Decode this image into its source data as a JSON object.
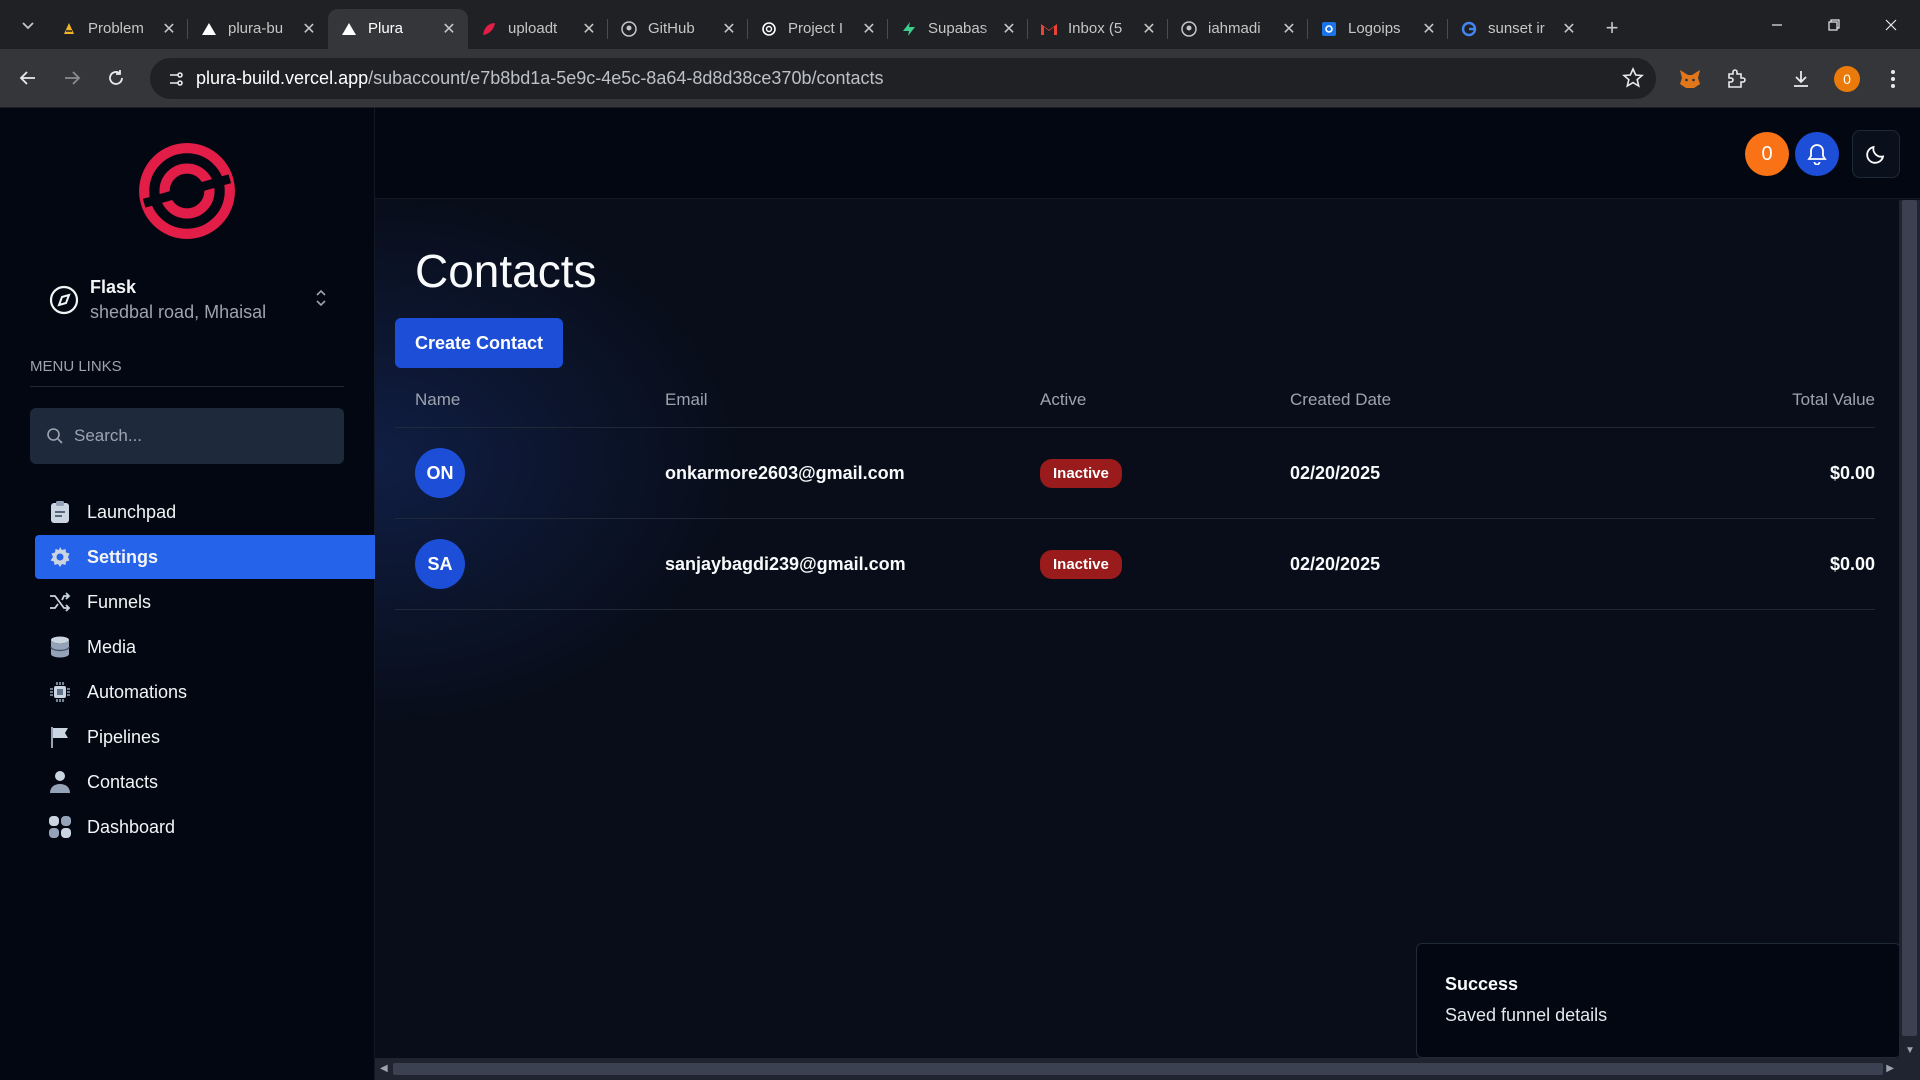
{
  "browser": {
    "tabs": [
      {
        "label": "Problem",
        "favicon": "vscode-icon",
        "color": "#f0b429"
      },
      {
        "label": "plura-bu",
        "favicon": "vercel-icon",
        "color": "#ffffff"
      },
      {
        "label": "Plura",
        "favicon": "vercel-icon",
        "color": "#ffffff",
        "active": true
      },
      {
        "label": "uploadt",
        "favicon": "uploadthing-icon",
        "color": "#e11d48"
      },
      {
        "label": "GitHub",
        "favicon": "github-icon",
        "color": "#c4c7c5"
      },
      {
        "label": "Project I",
        "favicon": "openai-icon",
        "color": "#ffffff"
      },
      {
        "label": "Supabas",
        "favicon": "supabase-icon",
        "color": "#3ecf8e"
      },
      {
        "label": "Inbox (5",
        "favicon": "gmail-icon",
        "color": "#ea4335"
      },
      {
        "label": "iahmadi",
        "favicon": "github-icon",
        "color": "#c4c7c5"
      },
      {
        "label": "Logoips",
        "favicon": "logoipsum-icon",
        "color": "#1a73e8"
      },
      {
        "label": "sunset ir",
        "favicon": "google-icon",
        "color": "#4285f4"
      }
    ],
    "url_host": "plura-build.vercel.app",
    "url_path": "/subaccount/e7b8bd1a-5e9c-4e5c-8a64-8d8d38ce370b/contacts",
    "profile_initial": "0"
  },
  "sidebar": {
    "account_name": "Flask",
    "account_address": "shedbal road, Mhaisal",
    "menu_label": "MENU LINKS",
    "search_placeholder": "Search...",
    "items": [
      {
        "label": "Launchpad",
        "icon": "clipboard-icon"
      },
      {
        "label": "Settings",
        "icon": "gear-icon",
        "active": true
      },
      {
        "label": "Funnels",
        "icon": "shuffle-icon"
      },
      {
        "label": "Media",
        "icon": "database-icon"
      },
      {
        "label": "Automations",
        "icon": "chip-icon"
      },
      {
        "label": "Pipelines",
        "icon": "flag-icon"
      },
      {
        "label": "Contacts",
        "icon": "person-icon"
      },
      {
        "label": "Dashboard",
        "icon": "grid-icon"
      }
    ]
  },
  "topbar": {
    "user_initial": "0"
  },
  "main": {
    "title": "Contacts",
    "create_button": "Create Contact",
    "columns": [
      "Name",
      "Email",
      "Active",
      "Created Date",
      "Total Value"
    ],
    "rows": [
      {
        "initials": "ON",
        "email": "onkarmore2603@gmail.com",
        "status": "Inactive",
        "created": "02/20/2025",
        "value": "$0.00"
      },
      {
        "initials": "SA",
        "email": "sanjaybagdi239@gmail.com",
        "status": "Inactive",
        "created": "02/20/2025",
        "value": "$0.00"
      }
    ]
  },
  "toast": {
    "title": "Success",
    "message": "Saved funnel details"
  },
  "colors": {
    "accent": "#2563eb",
    "inactive_badge": "#991b1b",
    "logo": "#e11d48",
    "user_badge": "#f97316"
  }
}
